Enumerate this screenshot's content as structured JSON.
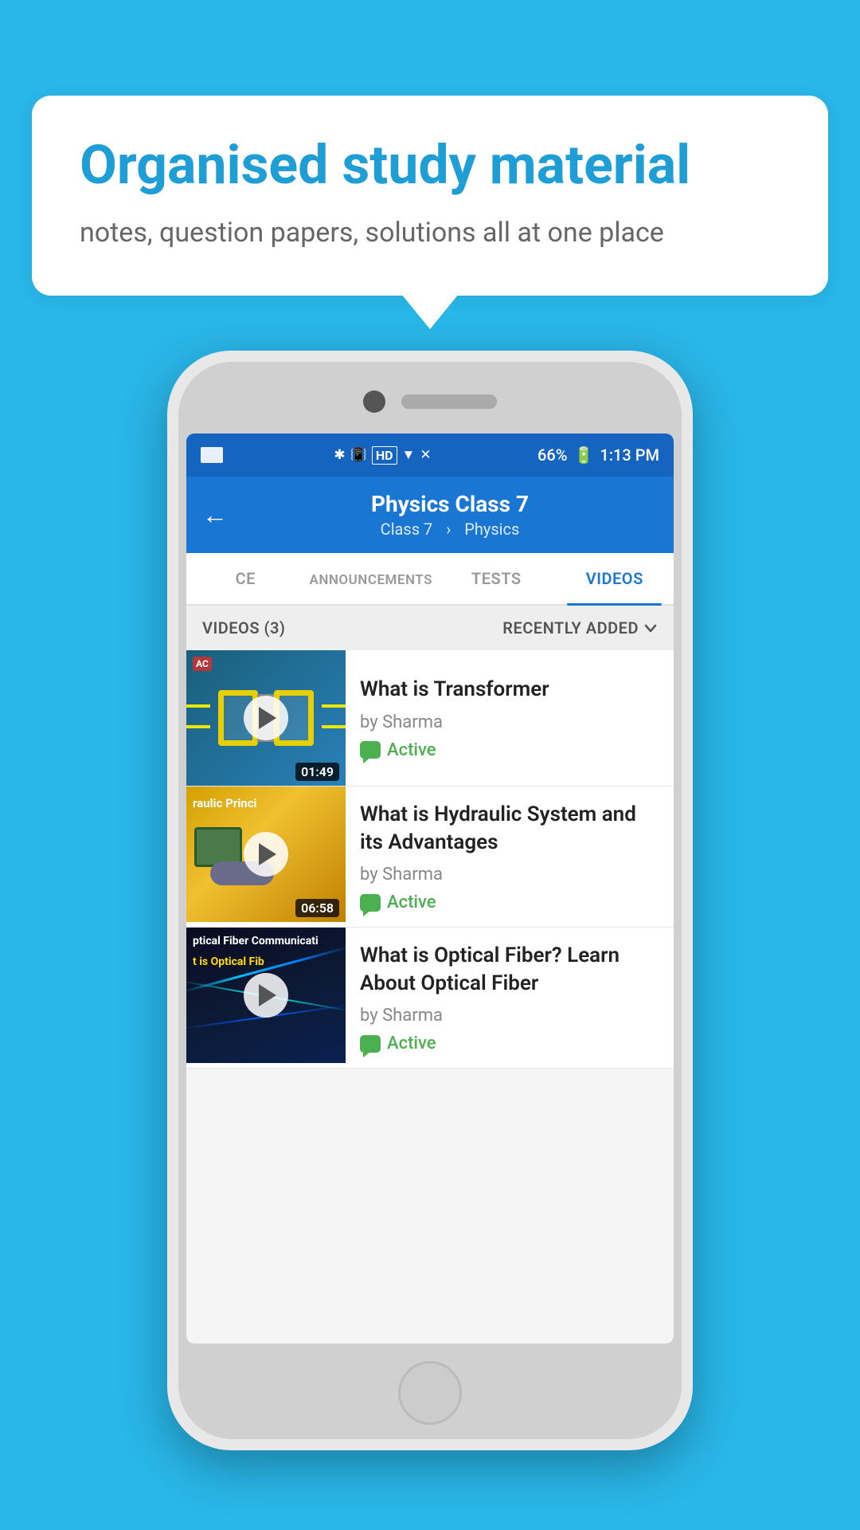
{
  "background": {
    "color": "#29b6e8"
  },
  "speech_bubble": {
    "title": "Organised study material",
    "subtitle": "notes, question papers, solutions all at one place"
  },
  "phone": {
    "status_bar": {
      "battery": "66%",
      "time": "1:13 PM"
    },
    "header": {
      "back_label": "←",
      "title": "Physics Class 7",
      "breadcrumb_class": "Class 7",
      "breadcrumb_subject": "Physics"
    },
    "tabs": [
      {
        "id": "ce",
        "label": "CE",
        "active": false
      },
      {
        "id": "announcements",
        "label": "ANNOUNCEMENTS",
        "active": false
      },
      {
        "id": "tests",
        "label": "TESTS",
        "active": false
      },
      {
        "id": "videos",
        "label": "VIDEOS",
        "active": true
      }
    ],
    "videos_header": {
      "count_label": "VIDEOS (3)",
      "sort_label": "RECENTLY ADDED"
    },
    "videos": [
      {
        "id": "transformer",
        "title": "What is  Transformer",
        "author": "by Sharma",
        "status": "Active",
        "duration": "01:49",
        "thumbnail_type": "transformer"
      },
      {
        "id": "hydraulic",
        "title": "What is Hydraulic System and its Advantages",
        "author": "by Sharma",
        "status": "Active",
        "duration": "06:58",
        "thumbnail_type": "hydraulic",
        "thumb_text_line1": "raulic Princi"
      },
      {
        "id": "optical",
        "title": "What is Optical Fiber? Learn About Optical Fiber",
        "author": "by Sharma",
        "status": "Active",
        "duration": "",
        "thumbnail_type": "optical",
        "thumb_text_line1": "ptical Fiber Communicati",
        "thumb_text_line2": "t is Optical Fib"
      }
    ]
  }
}
